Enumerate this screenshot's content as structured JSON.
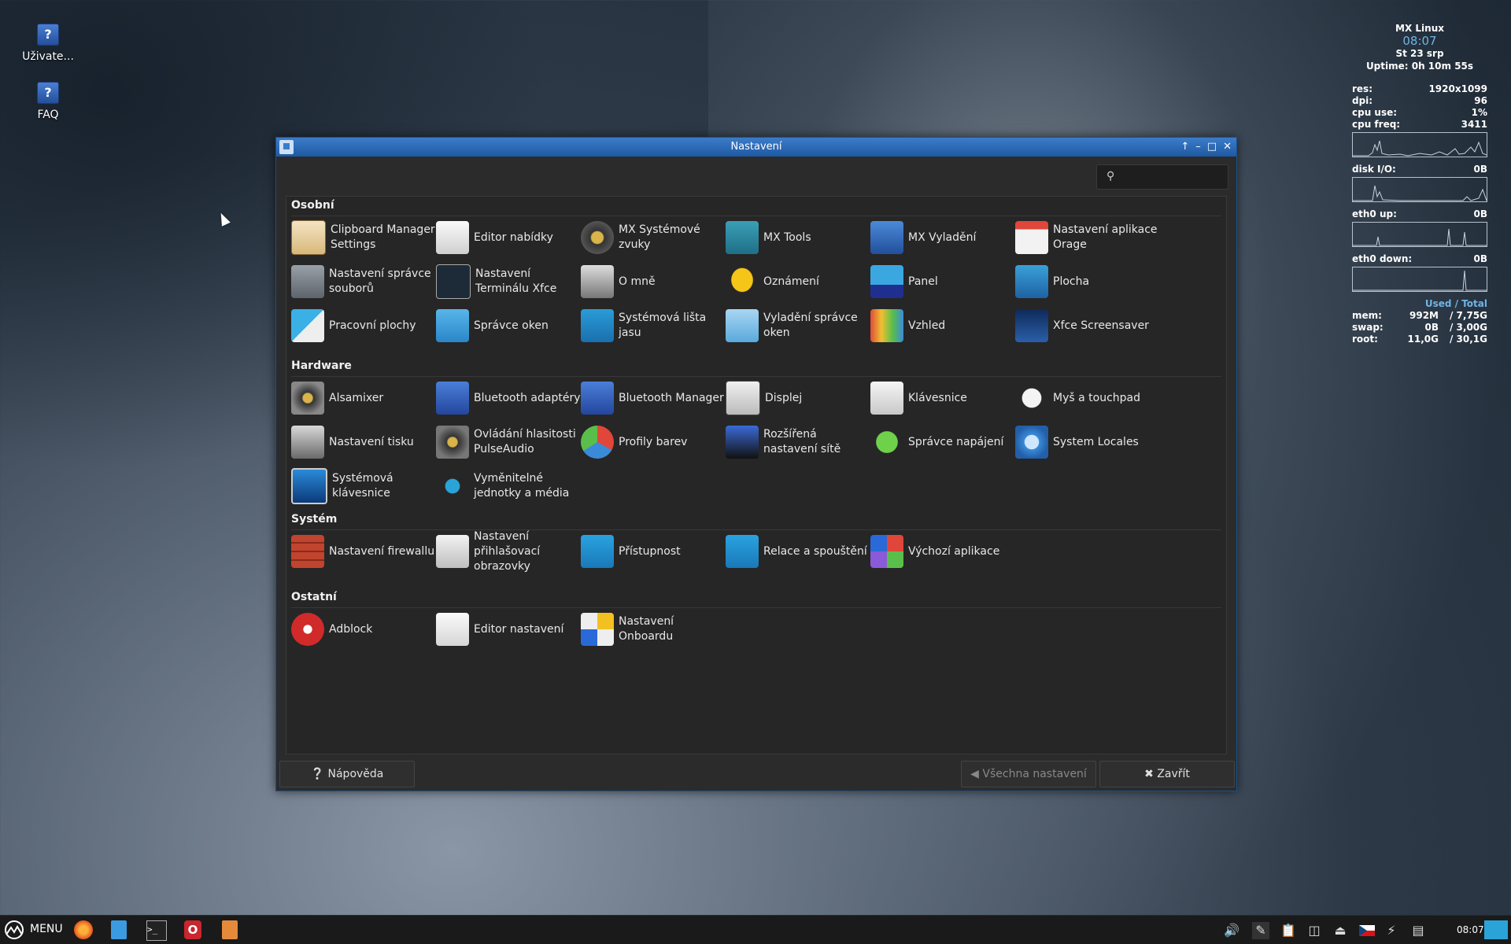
{
  "desktop": {
    "icons": [
      {
        "label": "Uživate...",
        "glyph": "?"
      },
      {
        "label": "FAQ",
        "glyph": "?"
      }
    ]
  },
  "conky": {
    "title": "MX Linux",
    "time": "08:07",
    "date": "St 23 srp",
    "uptime": "Uptime: 0h 10m 55s",
    "rows": [
      {
        "k": "res:",
        "v": "1920x1099"
      },
      {
        "k": "dpi:",
        "v": "96"
      },
      {
        "k": "cpu use:",
        "v": "1%"
      },
      {
        "k": "cpu freq:",
        "v": "3411"
      }
    ],
    "disk": {
      "k": "disk I/O:",
      "v": "0B"
    },
    "eth_up": {
      "k": "eth0 up:",
      "v": "0B"
    },
    "eth_down": {
      "k": "eth0 down:",
      "v": "0B"
    },
    "mem_head": "Used / Total",
    "mem": [
      {
        "k": "mem:",
        "used": "992M",
        "total": "/ 7,75G"
      },
      {
        "k": "swap:",
        "used": "0B",
        "total": "/ 3,00G"
      },
      {
        "k": "root:",
        "used": "11,0G",
        "total": "/ 30,1G"
      }
    ]
  },
  "window": {
    "title": "Nastavení",
    "search_placeholder": "",
    "sections": [
      {
        "title": "Osobní",
        "items": [
          {
            "label": "Clipboard Manager Settings",
            "icon": "clipboard-icon"
          },
          {
            "label": "Editor nabídky",
            "icon": "menu-editor-icon"
          },
          {
            "label": "MX Systémové zvuky",
            "icon": "speaker-icon"
          },
          {
            "label": "MX Tools",
            "icon": "tools-icon"
          },
          {
            "label": "MX Vyladění",
            "icon": "tweak-icon"
          },
          {
            "label": "Nastavení aplikace Orage",
            "icon": "calendar-icon"
          },
          {
            "label": "Nastavení správce souborů",
            "icon": "file-manager-icon"
          },
          {
            "label": "Nastavení Terminálu Xfce",
            "icon": "terminal-icon"
          },
          {
            "label": "O mně",
            "icon": "about-me-icon"
          },
          {
            "label": "Oznámení",
            "icon": "bell-icon"
          },
          {
            "label": "Panel",
            "icon": "panel-icon"
          },
          {
            "label": "Plocha",
            "icon": "desktop-icon"
          },
          {
            "label": "Pracovní plochy",
            "icon": "workspaces-icon"
          },
          {
            "label": "Správce oken",
            "icon": "window-manager-icon"
          },
          {
            "label": "Systémová lišta jasu",
            "icon": "brightness-icon"
          },
          {
            "label": "Vyladění správce oken",
            "icon": "window-tweaks-icon"
          },
          {
            "label": "Vzhled",
            "icon": "appearance-icon"
          },
          {
            "label": "Xfce Screensaver",
            "icon": "screensaver-icon"
          }
        ]
      },
      {
        "title": "Hardware",
        "items": [
          {
            "label": "Alsamixer",
            "icon": "mixer-icon"
          },
          {
            "label": "Bluetooth adaptéry",
            "icon": "bluetooth-icon"
          },
          {
            "label": "Bluetooth Manager",
            "icon": "bluetooth-icon"
          },
          {
            "label": "Displej",
            "icon": "display-icon"
          },
          {
            "label": "Klávesnice",
            "icon": "keyboard-icon"
          },
          {
            "label": "Myš a touchpad",
            "icon": "mouse-icon"
          },
          {
            "label": "Nastavení tisku",
            "icon": "printer-icon"
          },
          {
            "label": "Ovládání hlasitosti PulseAudio",
            "icon": "volume-icon"
          },
          {
            "label": "Profily barev",
            "icon": "color-profile-icon"
          },
          {
            "label": "Rozšířená nastavení sítě",
            "icon": "network-icon"
          },
          {
            "label": "Správce napájení",
            "icon": "battery-icon"
          },
          {
            "label": "System Locales",
            "icon": "globe-icon"
          },
          {
            "label": "Systémová klávesnice",
            "icon": "system-keyboard-icon"
          },
          {
            "label": "Vyměnitelné jednotky a média",
            "icon": "usb-icon"
          }
        ]
      },
      {
        "title": "Systém",
        "items": [
          {
            "label": "Nastavení firewallu",
            "icon": "firewall-icon"
          },
          {
            "label": "Nastavení přihlašovací obrazovky",
            "icon": "login-screen-icon"
          },
          {
            "label": "Přístupnost",
            "icon": "accessibility-icon"
          },
          {
            "label": "Relace a spouštění",
            "icon": "rocket-icon"
          },
          {
            "label": "Výchozí aplikace",
            "icon": "default-apps-icon"
          }
        ]
      },
      {
        "title": "Ostatní",
        "items": [
          {
            "label": "Adblock",
            "icon": "adblock-icon"
          },
          {
            "label": "Editor nastavení",
            "icon": "settings-editor-icon"
          },
          {
            "label": "Nastavení Onboardu",
            "icon": "onboard-icon"
          }
        ]
      }
    ],
    "footer": {
      "help": "Nápověda",
      "all_settings": "Všechna nastavení",
      "close": "Zavřít"
    }
  },
  "taskbar": {
    "menu_label": "MENU",
    "clock": "08:07"
  },
  "colors": {
    "accent": "#2e6fbf",
    "window_bg": "#2b2b2b",
    "pane_bg": "#262626"
  }
}
